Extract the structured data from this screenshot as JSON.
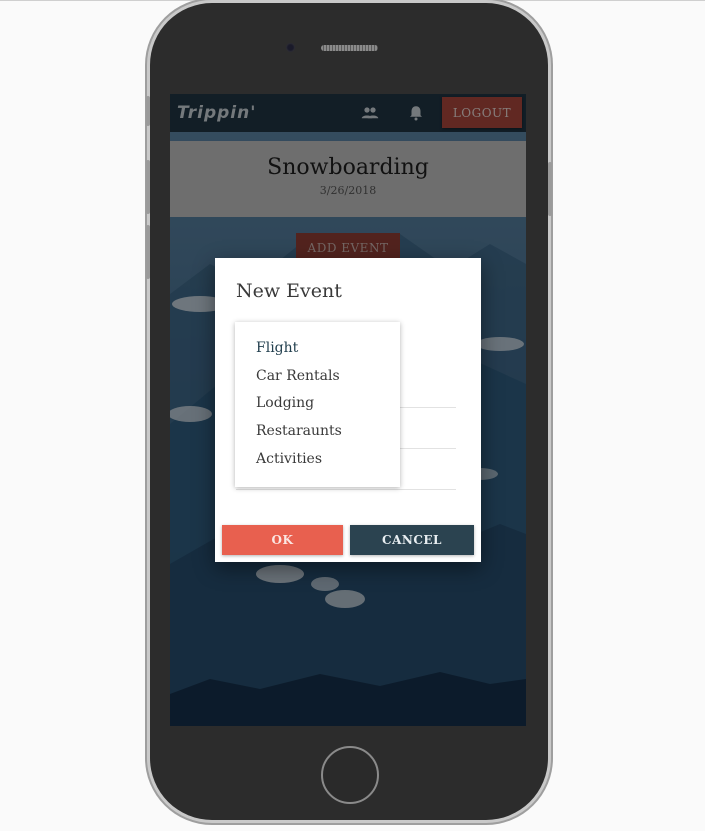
{
  "app": {
    "logo_text": "Trippin'"
  },
  "navbar": {
    "icons": [
      "people-icon",
      "bell-icon"
    ],
    "logout_label": "LOGOUT"
  },
  "trip": {
    "title": "Snowboarding",
    "date": "3/26/2018",
    "add_event_label": "ADD EVENT"
  },
  "dialog": {
    "title": "New Event",
    "menu_items": [
      "Flight",
      "Car Rentals",
      "Lodging",
      "Restaraunts",
      "Activities"
    ],
    "ok_label": "OK",
    "cancel_label": "CANCEL"
  },
  "colors": {
    "navbar_bg": "#1f3443",
    "accent_red": "#e8604f",
    "dark_teal": "#2b4350",
    "header_gray": "#bdbdbd"
  }
}
